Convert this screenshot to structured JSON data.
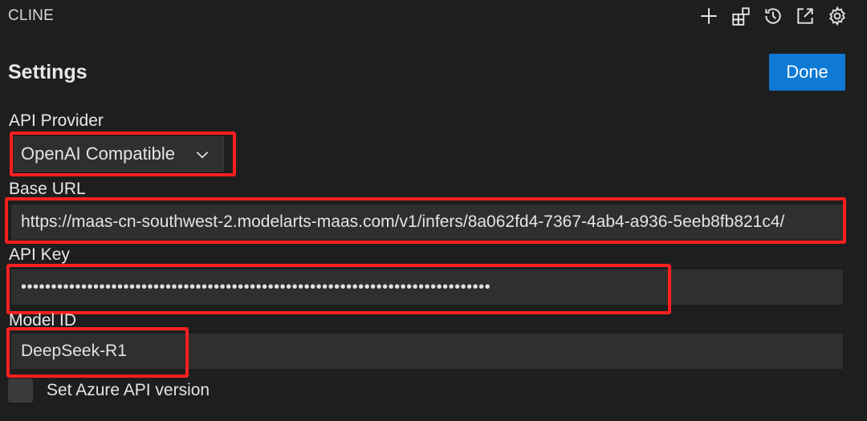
{
  "header": {
    "title": "CLINE",
    "actions": [
      {
        "icon": "plus-icon"
      },
      {
        "icon": "extensions-icon"
      },
      {
        "icon": "history-icon"
      },
      {
        "icon": "popout-icon"
      },
      {
        "icon": "gear-icon"
      }
    ]
  },
  "settings": {
    "title": "Settings",
    "done_label": "Done",
    "api_provider": {
      "label": "API Provider",
      "value": "OpenAI Compatible"
    },
    "base_url": {
      "label": "Base URL",
      "value": "https://maas-cn-southwest-2.modelarts-maas.com/v1/infers/8a062fd4-7367-4ab4-a936-5eeb8fb821c4/"
    },
    "api_key": {
      "label": "API Key",
      "masked_value": "••••••••••••••••••••••••••••••••••••••••••••••••••••••••••••••••••••••••••••••"
    },
    "model_id": {
      "label": "Model ID",
      "value": "DeepSeek-R1"
    },
    "azure_checkbox": {
      "label": "Set Azure API version",
      "checked": false
    }
  },
  "colors": {
    "background": "#1e1e1e",
    "field_bg": "#2f2f2f",
    "button_primary": "#0e7ad4",
    "highlight": "#ff1f1f"
  }
}
